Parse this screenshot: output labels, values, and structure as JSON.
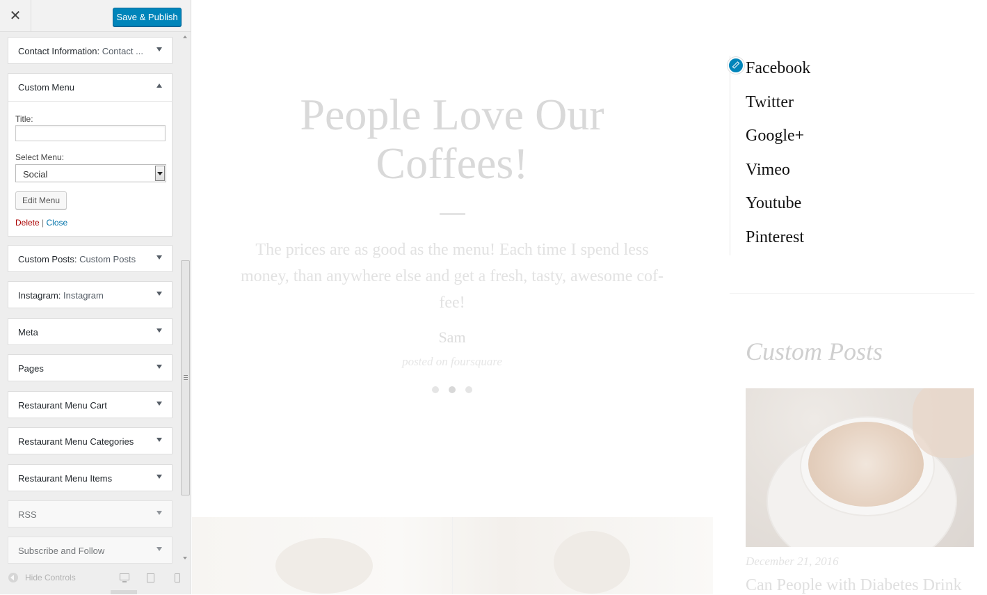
{
  "sidebar": {
    "close_symbol": "✕",
    "publish_label": "Save & Publish",
    "panels_top": [
      {
        "title": "Contact Information:",
        "subtitle": "Contact ..."
      }
    ],
    "custom_menu": {
      "title": "Custom Menu",
      "title_label": "Title:",
      "title_value": "",
      "select_label": "Select Menu:",
      "select_value": "Social",
      "edit_button": "Edit Menu",
      "delete_link": "Delete",
      "separator": "|",
      "close_link": "Close"
    },
    "panels": [
      {
        "title": "Custom Posts:",
        "subtitle": "Custom Posts"
      },
      {
        "title": "Instagram:",
        "subtitle": "Instagram"
      },
      {
        "title": "Meta",
        "subtitle": ""
      },
      {
        "title": "Pages",
        "subtitle": ""
      },
      {
        "title": "Restaurant Menu Cart",
        "subtitle": ""
      },
      {
        "title": "Restaurant Menu Categories",
        "subtitle": ""
      },
      {
        "title": "Restaurant Menu Items",
        "subtitle": ""
      },
      {
        "title": "RSS",
        "subtitle": ""
      },
      {
        "title": "Subscribe and Follow",
        "subtitle": ""
      }
    ],
    "footer": {
      "hide_controls": "Hide Controls",
      "devices": [
        "desktop-icon",
        "tablet-icon",
        "mobile-icon"
      ]
    }
  },
  "preview": {
    "testimonial": {
      "heading": "People Love Our Coffees!",
      "quote": "The prices are as good as the menu! Each time I spend less money, than anywhere else and get a fresh, tasty, awesome cof-fee!",
      "author": "Sam",
      "source": "posted on foursquare",
      "active_slide": 2,
      "slide_count": 3
    },
    "social_menu": [
      "Facebook",
      "Twitter",
      "Google+",
      "Vimeo",
      "Youtube",
      "Pinterest"
    ],
    "custom_posts": {
      "title": "Custom Posts",
      "post_date": "December 21, 2016",
      "post_title": "Can People with Diabetes Drink"
    }
  },
  "colors": {
    "publish_blue": "#0085ba",
    "delete_red": "#aa0000",
    "link_blue": "#0073aa",
    "sidebar_bg": "#eeeeee"
  }
}
